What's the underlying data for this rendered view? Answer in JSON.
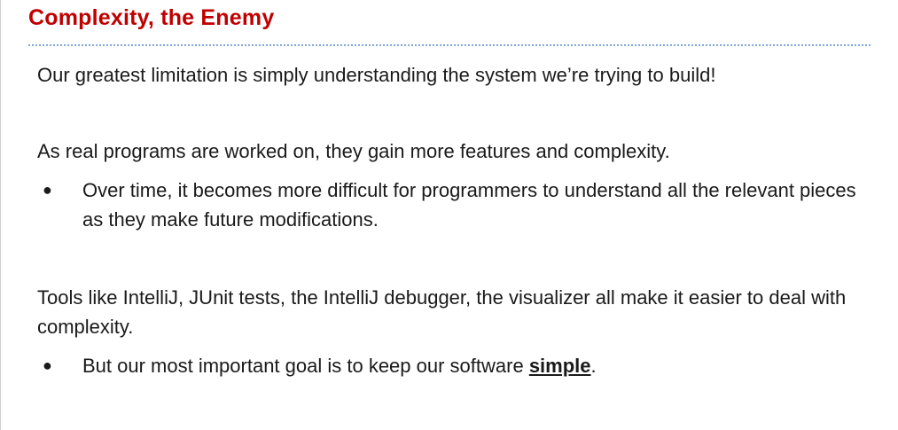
{
  "slide": {
    "title": "Complexity, the Enemy",
    "paragraph1": "Our greatest limitation is simply understanding the system we’re trying to build!",
    "paragraph2": "As real programs are worked on, they gain more features and complexity.",
    "bullet1": "Over time, it becomes more difficult for programmers to understand all the relevant pieces as they make future modifications.",
    "paragraph3": "Tools like IntelliJ, JUnit tests, the IntelliJ debugger, the visualizer all make it easier to deal with complexity.",
    "bullet2_prefix": "But our most important goal is to keep our software ",
    "bullet2_emphasis": "simple",
    "bullet2_suffix": ".",
    "bullet_glyph": "●"
  }
}
